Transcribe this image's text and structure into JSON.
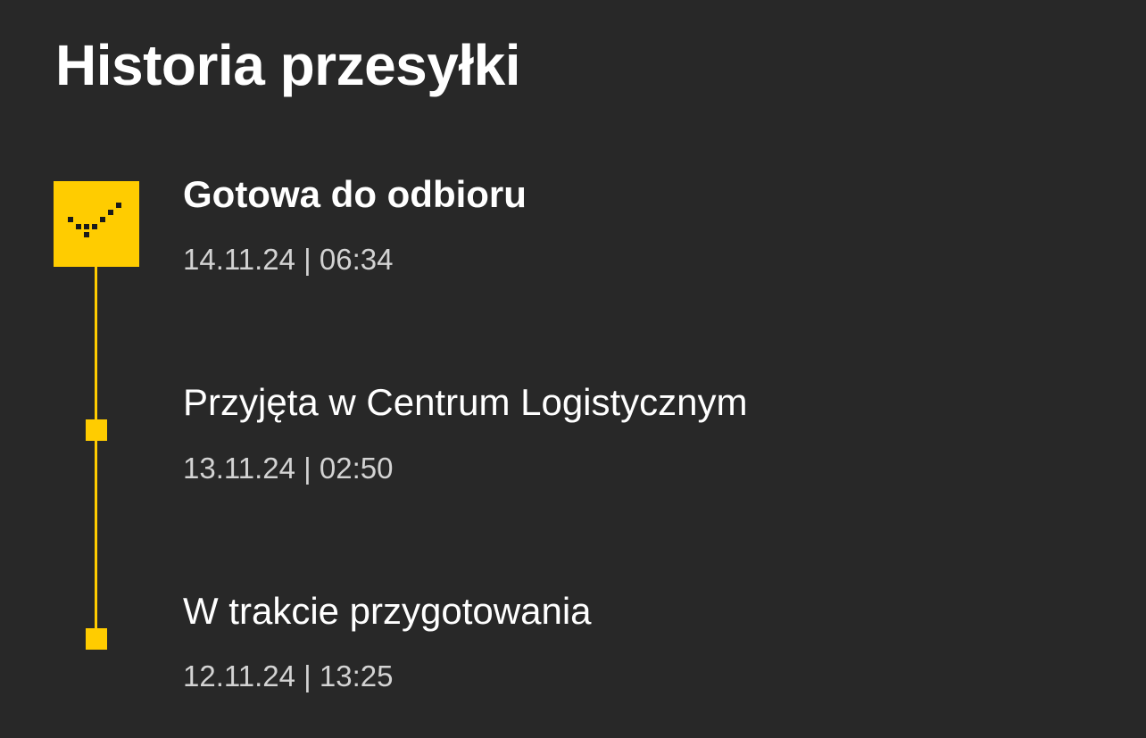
{
  "page": {
    "title": "Historia przesyłki"
  },
  "colors": {
    "background": "#282828",
    "accent": "#ffcc00",
    "text_primary": "#ffffff",
    "text_secondary": "#d3d3d3"
  },
  "timeline": {
    "events": [
      {
        "title": "Gotowa do odbioru",
        "timestamp": "14.11.24 | 06:34",
        "current": true,
        "icon": "checkmark-icon"
      },
      {
        "title": "Przyjęta w Centrum Logistycznym",
        "timestamp": "13.11.24 | 02:50",
        "current": false,
        "icon": "status-dot-icon"
      },
      {
        "title": "W trakcie przygotowania",
        "timestamp": "12.11.24 | 13:25",
        "current": false,
        "icon": "status-dot-icon"
      }
    ]
  }
}
